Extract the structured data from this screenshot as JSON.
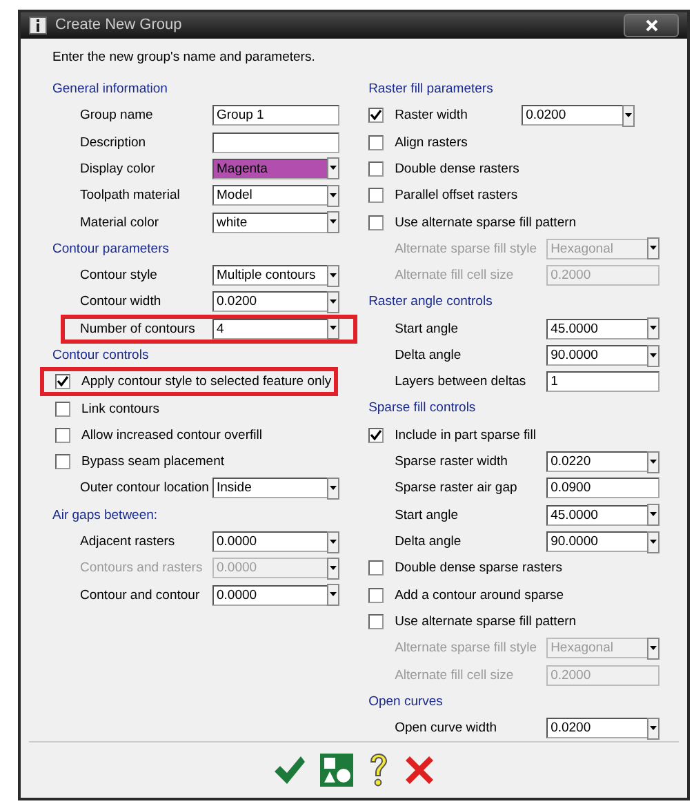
{
  "window": {
    "title": "Create New Group"
  },
  "intro": "Enter the new group's name and parameters.",
  "columns": [
    {
      "sections": [
        {
          "title": "General information",
          "rows": [
            {
              "kind": "field",
              "label": "Group name",
              "value": "Group 1",
              "dropdown": false,
              "disabled": false,
              "highlighted": false
            },
            {
              "kind": "field",
              "label": "Description",
              "dropdown": false,
              "disabled": false,
              "highlighted": false
            },
            {
              "kind": "field",
              "label": "Display color",
              "value": "Magenta",
              "dropdown": true,
              "disabled": false,
              "highlighted": false,
              "color": "#b24fae"
            },
            {
              "kind": "field",
              "label": "Toolpath material",
              "value": "Model",
              "dropdown": true,
              "disabled": false,
              "highlighted": false
            },
            {
              "kind": "field",
              "label": "Material color",
              "value": "white",
              "dropdown": true,
              "disabled": false,
              "highlighted": false
            }
          ]
        },
        {
          "title": "Contour parameters",
          "rows": [
            {
              "kind": "field",
              "label": "Contour style",
              "value": "Multiple contours",
              "dropdown": true,
              "disabled": false,
              "highlighted": false
            },
            {
              "kind": "field",
              "label": "Contour width",
              "value": "0.0200",
              "dropdown": true,
              "disabled": false,
              "highlighted": false
            },
            {
              "kind": "field",
              "label": "Number of contours",
              "value": "4",
              "dropdown": true,
              "disabled": false,
              "highlighted": true
            }
          ]
        },
        {
          "title": "Contour controls",
          "rows": [
            {
              "kind": "check",
              "label": "Apply contour style to selected feature only",
              "checked": true,
              "highlighted": true
            },
            {
              "kind": "check",
              "label": "Link contours",
              "checked": false,
              "highlighted": false
            },
            {
              "kind": "check",
              "label": "Allow increased contour overfill",
              "checked": false,
              "highlighted": false
            },
            {
              "kind": "check",
              "label": "Bypass seam placement",
              "checked": false,
              "highlighted": false
            },
            {
              "kind": "field",
              "label": "Outer contour location",
              "value": "Inside",
              "dropdown": true,
              "disabled": false,
              "highlighted": false
            }
          ]
        },
        {
          "title": "Air gaps between:",
          "rows": [
            {
              "kind": "field",
              "label": "Adjacent rasters",
              "value": "0.0000",
              "dropdown": true,
              "disabled": false,
              "highlighted": false
            },
            {
              "kind": "field",
              "label": "Contours and rasters",
              "value": "0.0000",
              "dropdown": true,
              "disabled": true,
              "highlighted": false
            },
            {
              "kind": "field",
              "label": "Contour and contour",
              "value": "0.0000",
              "dropdown": true,
              "disabled": false,
              "highlighted": false
            }
          ]
        }
      ]
    },
    {
      "sections": [
        {
          "title": "Raster fill parameters",
          "rows": [
            {
              "kind": "check",
              "label": "Raster width",
              "checked": true,
              "highlighted": false,
              "field": {
                "value": "0.0200",
                "dropdown": true
              }
            },
            {
              "kind": "check",
              "label": "Align rasters",
              "checked": false,
              "highlighted": false
            },
            {
              "kind": "check",
              "label": "Double dense rasters",
              "checked": false,
              "highlighted": false
            },
            {
              "kind": "check",
              "label": "Parallel offset rasters",
              "checked": false,
              "highlighted": false
            },
            {
              "kind": "check",
              "label": "Use alternate sparse fill pattern",
              "checked": false,
              "highlighted": false
            },
            {
              "kind": "field",
              "label": "Alternate sparse fill style",
              "value": "Hexagonal",
              "dropdown": true,
              "disabled": true,
              "highlighted": false
            },
            {
              "kind": "field",
              "label": "Alternate fill cell size",
              "value": "0.2000",
              "dropdown": false,
              "disabled": true,
              "highlighted": false
            }
          ]
        },
        {
          "title": "Raster angle controls",
          "rows": [
            {
              "kind": "field",
              "label": "Start angle",
              "value": "45.0000",
              "dropdown": true,
              "disabled": false,
              "highlighted": false
            },
            {
              "kind": "field",
              "label": "Delta angle",
              "value": "90.0000",
              "dropdown": true,
              "disabled": false,
              "highlighted": false
            },
            {
              "kind": "field",
              "label": "Layers between deltas",
              "value": "1",
              "dropdown": false,
              "disabled": false,
              "highlighted": false
            }
          ]
        },
        {
          "title": "Sparse fill controls",
          "rows": [
            {
              "kind": "check",
              "label": "Include in part sparse fill",
              "checked": true,
              "highlighted": false
            },
            {
              "kind": "field",
              "label": "Sparse raster width",
              "value": "0.0220",
              "dropdown": true,
              "disabled": false,
              "highlighted": false
            },
            {
              "kind": "field",
              "label": "Sparse raster air gap",
              "value": "0.0900",
              "dropdown": false,
              "disabled": false,
              "highlighted": false
            },
            {
              "kind": "field",
              "label": "Start angle",
              "value": "45.0000",
              "dropdown": true,
              "disabled": false,
              "highlighted": false
            },
            {
              "kind": "field",
              "label": "Delta angle",
              "value": "90.0000",
              "dropdown": true,
              "disabled": false,
              "highlighted": false
            },
            {
              "kind": "check",
              "label": "Double dense sparse rasters",
              "checked": false,
              "highlighted": false
            },
            {
              "kind": "check",
              "label": "Add a contour around sparse",
              "checked": false,
              "highlighted": false
            },
            {
              "kind": "check",
              "label": "Use alternate sparse fill pattern",
              "checked": false,
              "highlighted": false
            },
            {
              "kind": "field",
              "label": "Alternate sparse fill style",
              "value": "Hexagonal",
              "dropdown": true,
              "disabled": true,
              "highlighted": false
            },
            {
              "kind": "field",
              "label": "Alternate fill cell size",
              "value": "0.2000",
              "dropdown": false,
              "disabled": true,
              "highlighted": false
            }
          ]
        },
        {
          "title": "Open curves",
          "rows": [
            {
              "kind": "field",
              "label": "Open curve width",
              "value": "0.0200",
              "dropdown": true,
              "disabled": false,
              "highlighted": false
            }
          ]
        }
      ]
    }
  ]
}
